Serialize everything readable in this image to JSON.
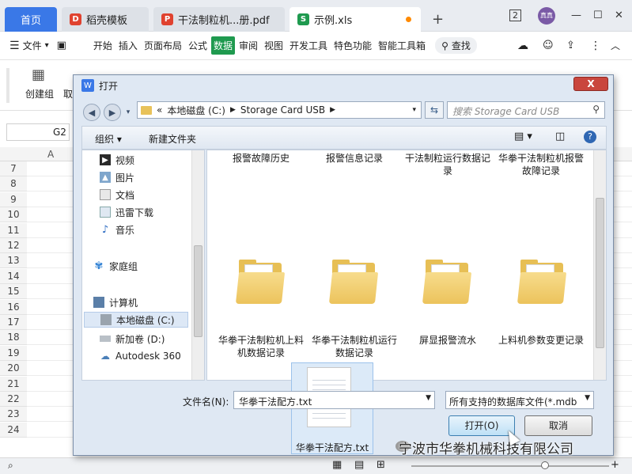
{
  "tabs": [
    {
      "label": "首页",
      "type": "home"
    },
    {
      "label": "稻壳模板",
      "icon": "docer-icon",
      "color": "#e0422f"
    },
    {
      "label": "干法制粒机...册.pdf",
      "icon": "pdf-icon",
      "color": "#e0422f"
    },
    {
      "label": "示例.xls",
      "icon": "sheet-icon",
      "color": "#1f9a4f",
      "active": true
    }
  ],
  "titlebar": {
    "new_tab": "+",
    "page_count": "2",
    "avatar_text": "真真",
    "min": "—",
    "restore": "☐",
    "close": "✕"
  },
  "menu": {
    "file": "文件",
    "items": [
      "开始",
      "插入",
      "页面布局",
      "公式",
      "数据",
      "审阅",
      "视图",
      "开发工具",
      "特色功能",
      "智能工具箱"
    ],
    "active": "数据",
    "search": "查找"
  },
  "ribbon": {
    "create_group": "创建组",
    "cut_partial": "取"
  },
  "sheet": {
    "cell_ref": "G2",
    "column": "A",
    "rows": [
      "7",
      "8",
      "9",
      "10",
      "11",
      "12",
      "13",
      "14",
      "15",
      "16",
      "17",
      "18",
      "19",
      "20",
      "21",
      "22",
      "23",
      "24"
    ]
  },
  "dialog": {
    "title": "打开",
    "close": "X",
    "address": {
      "prefix": "«",
      "segments": [
        "本地磁盘 (C:)",
        "Storage Card USB"
      ]
    },
    "search_placeholder": "搜索 Storage Card USB",
    "toolbar": {
      "organize": "组织 ▾",
      "new_folder": "新建文件夹"
    },
    "tree": [
      {
        "label": "视频",
        "icon": "video-icon"
      },
      {
        "label": "图片",
        "icon": "picture-icon"
      },
      {
        "label": "文档",
        "icon": "document-icon"
      },
      {
        "label": "迅雷下载",
        "icon": "download-icon"
      },
      {
        "label": "音乐",
        "icon": "music-icon"
      },
      {
        "label": "家庭组",
        "icon": "homegroup-icon"
      },
      {
        "label": "计算机",
        "icon": "computer-icon"
      },
      {
        "label": "本地磁盘 (C:)",
        "icon": "drive-icon",
        "selected": true
      },
      {
        "label": "新加卷 (D:)",
        "icon": "drive-icon"
      },
      {
        "label": "Autodesk 360",
        "icon": "cloud-icon"
      }
    ],
    "files_top_row": [
      "报警故障历史",
      "报警信息记录",
      "干法制粒运行数据记录",
      "华拳干法制粒机报警故障记录"
    ],
    "folders": [
      "华拳干法制粒机上料机数据记录",
      "华拳干法制粒机运行数据记录",
      "屏显报警流水",
      "上料机参数变更记录"
    ],
    "selected_file": "华拳干法配方.txt",
    "filename_label": "文件名(N):",
    "filename_value": "华拳干法配方.txt",
    "filetype": "所有支持的数据库文件(*.mdb",
    "open_button": "打开(O)",
    "cancel_button": "取消"
  },
  "watermark": "宁波市华拳机械科技有限公司"
}
